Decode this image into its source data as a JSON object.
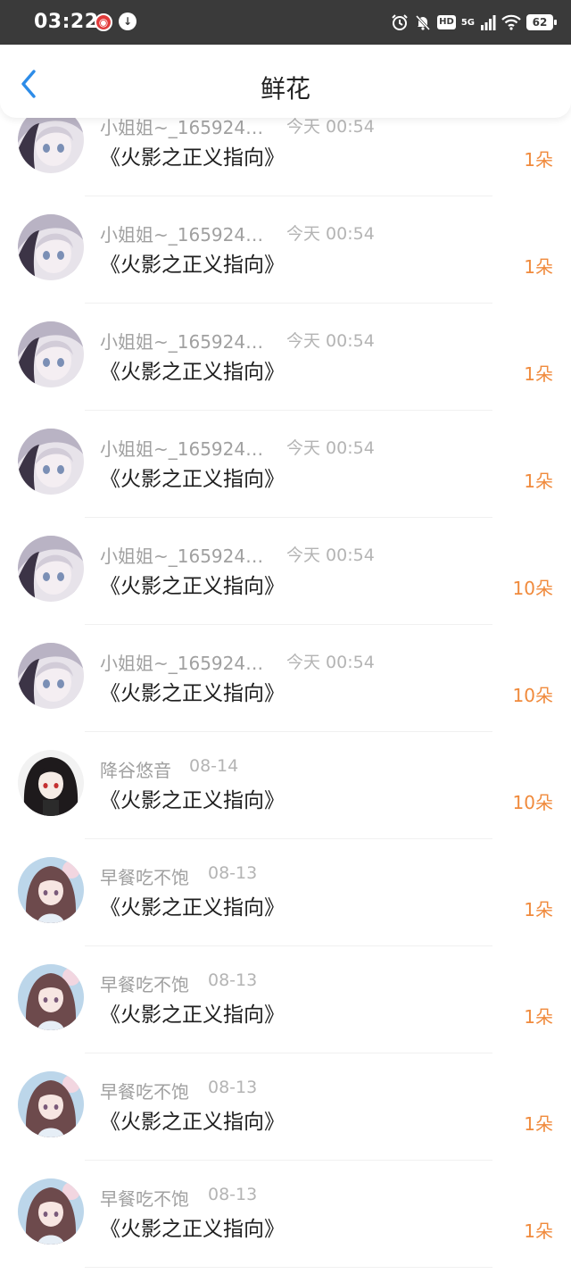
{
  "status_bar": {
    "time": "03:22",
    "battery": "62",
    "network": "5G",
    "hd": "HD",
    "icons": [
      "netease-music-icon",
      "app-icon",
      "alarm-icon",
      "mute-icon",
      "hd-icon",
      "signal-icon",
      "wifi-icon",
      "battery-icon"
    ]
  },
  "header": {
    "title": "鲜花",
    "back_icon": "chevron-left-icon"
  },
  "colors": {
    "accent_blue": "#2d8ce8",
    "count_orange": "#f08a3c"
  },
  "items": [
    {
      "name": "小姐姐~_165924…",
      "time": "今天 00:54",
      "work": "《火影之正义指向》",
      "count": "1朵",
      "avatar": "anime-girl-gray"
    },
    {
      "name": "小姐姐~_165924…",
      "time": "今天 00:54",
      "work": "《火影之正义指向》",
      "count": "1朵",
      "avatar": "anime-girl-gray"
    },
    {
      "name": "小姐姐~_165924…",
      "time": "今天 00:54",
      "work": "《火影之正义指向》",
      "count": "1朵",
      "avatar": "anime-girl-gray"
    },
    {
      "name": "小姐姐~_165924…",
      "time": "今天 00:54",
      "work": "《火影之正义指向》",
      "count": "1朵",
      "avatar": "anime-girl-gray"
    },
    {
      "name": "小姐姐~_165924…",
      "time": "今天 00:54",
      "work": "《火影之正义指向》",
      "count": "10朵",
      "avatar": "anime-girl-gray"
    },
    {
      "name": "小姐姐~_165924…",
      "time": "今天 00:54",
      "work": "《火影之正义指向》",
      "count": "10朵",
      "avatar": "anime-girl-gray"
    },
    {
      "name": "降谷悠音",
      "time": "08-14",
      "work": "《火影之正义指向》",
      "count": "10朵",
      "avatar": "anime-girl-dark"
    },
    {
      "name": "早餐吃不饱",
      "time": "08-13",
      "work": "《火影之正义指向》",
      "count": "1朵",
      "avatar": "anime-girl-pink"
    },
    {
      "name": "早餐吃不饱",
      "time": "08-13",
      "work": "《火影之正义指向》",
      "count": "1朵",
      "avatar": "anime-girl-pink"
    },
    {
      "name": "早餐吃不饱",
      "time": "08-13",
      "work": "《火影之正义指向》",
      "count": "1朵",
      "avatar": "anime-girl-pink"
    },
    {
      "name": "早餐吃不饱",
      "time": "08-13",
      "work": "《火影之正义指向》",
      "count": "1朵",
      "avatar": "anime-girl-pink"
    }
  ]
}
